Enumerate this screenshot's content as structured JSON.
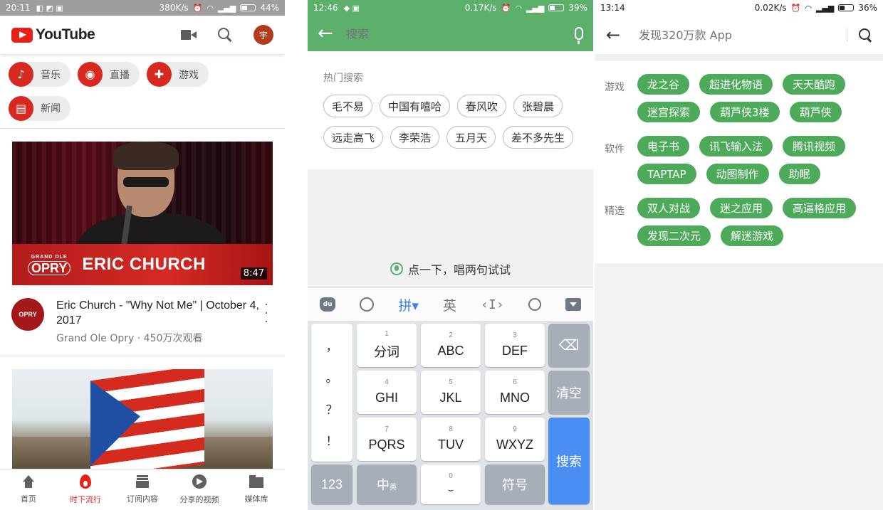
{
  "youtube": {
    "status": {
      "time": "20:11",
      "speed": "380K/s",
      "battery": "44%"
    },
    "logo_text": "YouTube",
    "avatar_letter": "宇",
    "chips": [
      {
        "label": "音乐",
        "icon": "music-note-icon"
      },
      {
        "label": "直播",
        "icon": "live-broadcast-icon"
      },
      {
        "label": "游戏",
        "icon": "gamepad-icon"
      },
      {
        "label": "新闻",
        "icon": "news-icon"
      }
    ],
    "video1": {
      "banner_small": "GRAND OLE",
      "banner_logo": "OPRY",
      "banner_name": "ERIC CHURCH",
      "duration": "8:47",
      "channel_avatar_text": "OPRY",
      "title": "Eric Church - \"Why Not Me\" | October 4, 2017",
      "subtitle": "Grand Ole Opry · 450万次观看"
    },
    "tabs": [
      {
        "label": "首页",
        "icon": "home-icon"
      },
      {
        "label": "时下流行",
        "icon": "trending-flame-icon",
        "active": true
      },
      {
        "label": "订阅内容",
        "icon": "subscriptions-icon"
      },
      {
        "label": "分享的视频",
        "icon": "shared-videos-icon"
      },
      {
        "label": "媒体库",
        "icon": "library-folder-icon"
      }
    ],
    "accent": "#e62117"
  },
  "search": {
    "status": {
      "time": "12:46",
      "speed": "0.17K/s",
      "battery": "39%"
    },
    "placeholder": "搜索",
    "hot_label": "热门搜索",
    "hot_tags": [
      "毛不易",
      "中国有嘻哈",
      "春风吹",
      "张碧晨",
      "远走高飞",
      "李荣浩",
      "五月天",
      "差不多先生"
    ],
    "hint": "点一下，唱两句试试",
    "toolbar": {
      "du": "du",
      "pinyin": "拼",
      "english": "英"
    },
    "keyboard": {
      "punct": [
        "，",
        "。",
        "？",
        "！"
      ],
      "keys": [
        {
          "num": "1",
          "label": "分词"
        },
        {
          "num": "2",
          "label": "ABC"
        },
        {
          "num": "3",
          "label": "DEF"
        },
        {
          "num": "4",
          "label": "GHI"
        },
        {
          "num": "5",
          "label": "JKL"
        },
        {
          "num": "6",
          "label": "MNO"
        },
        {
          "num": "7",
          "label": "PQRS"
        },
        {
          "num": "8",
          "label": "TUV"
        },
        {
          "num": "9",
          "label": "WXYZ"
        }
      ],
      "clear": "清空",
      "search": "搜索",
      "num_mode": "123",
      "zh_mode": "中",
      "zh_sub": "英",
      "space_num": "0",
      "symbols": "符号"
    },
    "accent": "#5cb06c"
  },
  "appstore": {
    "status": {
      "time": "13:14",
      "speed": "0.02K/s",
      "battery": "36%"
    },
    "placeholder": "发现320万款 App",
    "categories": [
      {
        "label": "游戏",
        "tags": [
          "龙之谷",
          "超进化物语",
          "天天酷跑",
          "迷宫探索",
          "葫芦侠3楼",
          "葫芦侠"
        ]
      },
      {
        "label": "软件",
        "tags": [
          "电子书",
          "讯飞输入法",
          "腾讯视频",
          "TAPTAP",
          "动图制作",
          "助眠"
        ]
      },
      {
        "label": "精选",
        "tags": [
          "双人对战",
          "迷之应用",
          "高逼格应用",
          "发现二次元",
          "解迷游戏"
        ]
      }
    ],
    "accent": "#4caa5a"
  }
}
